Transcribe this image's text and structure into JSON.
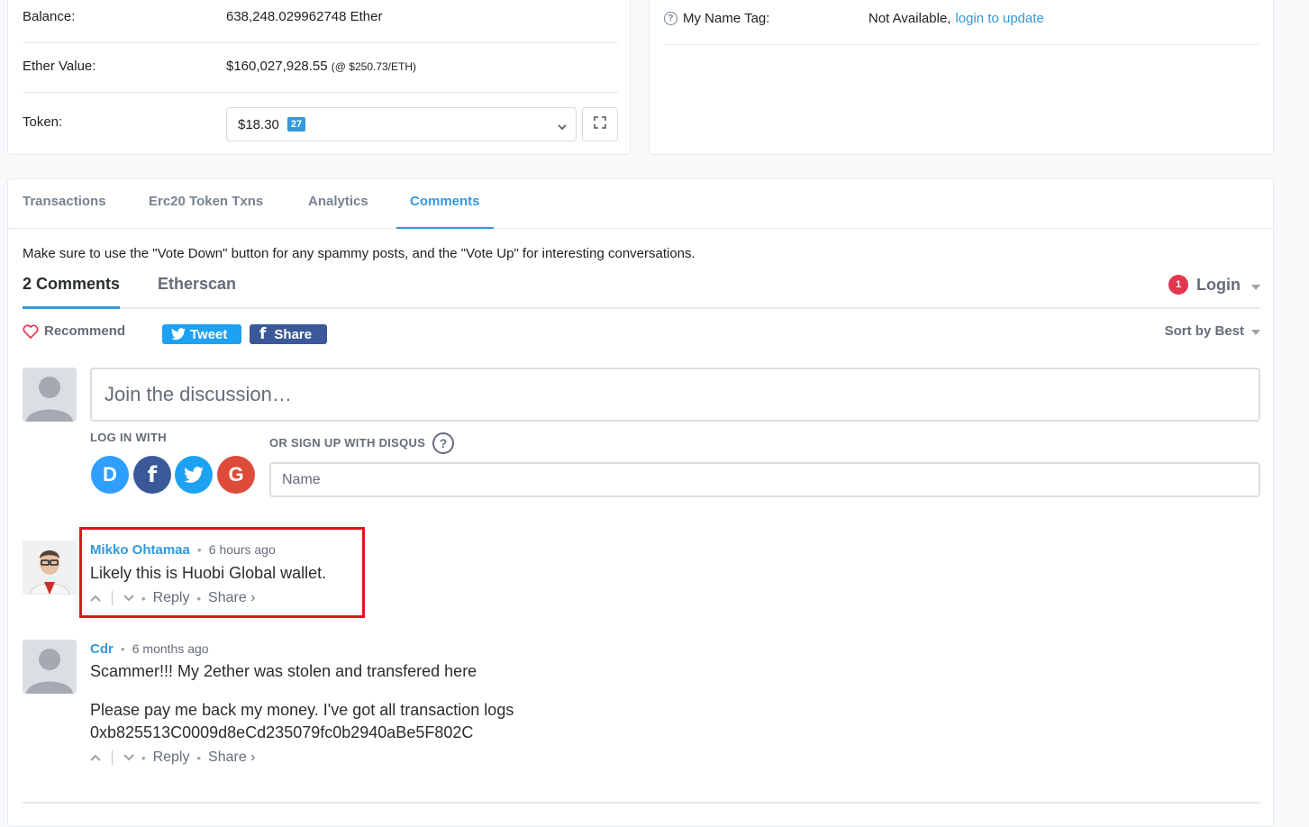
{
  "overview": {
    "balance_label": "Balance:",
    "balance_value": "638,248.029962748 Ether",
    "ether_value_label": "Ether Value:",
    "ether_value": "$160,027,928.55",
    "ether_rate": "(@ $250.73/ETH)",
    "token_label": "Token:",
    "token_value": "$18.30",
    "token_count": "27"
  },
  "more_info": {
    "name_tag_label": "My Name Tag:",
    "name_tag_value": "Not Available,",
    "name_tag_link": "login to update"
  },
  "tabs": [
    {
      "label": "Transactions"
    },
    {
      "label": "Erc20 Token Txns"
    },
    {
      "label": "Analytics"
    },
    {
      "label": "Comments",
      "active": true
    }
  ],
  "notice": "Make sure to use the \"Vote Down\" button for any spammy posts, and the \"Vote Up\" for interesting conversations.",
  "disqus": {
    "comment_count": "2 Comments",
    "forum_name": "Etherscan",
    "notification_count": "1",
    "login_label": "Login",
    "recommend_label": "Recommend",
    "tweet_label": "Tweet",
    "share_label": "Share",
    "sort_label": "Sort by Best",
    "composer_placeholder": "Join the discussion…",
    "log_in_with": "LOG IN WITH",
    "or_sign_up": "OR SIGN UP WITH DISQUS",
    "name_placeholder": "Name",
    "social_logins": [
      "D",
      "f",
      "t",
      "G"
    ]
  },
  "comments": [
    {
      "author": "Mikko Ohtamaa",
      "time": "6 hours ago",
      "text": [
        "Likely this is Huobi Global wallet."
      ],
      "reply_label": "Reply",
      "share_label": "Share ›"
    },
    {
      "author": "Cdr",
      "time": "6 months ago",
      "text": [
        "Scammer!!! My 2ether was stolen and transfered here",
        "Please pay me back my money. I've got all transaction logs",
        "0xb825513C0009d8eCd235079fc0b2940aBe5F802C"
      ],
      "reply_label": "Reply",
      "share_label": "Share ›"
    }
  ],
  "colors": {
    "accent": "#3498db",
    "highlight": "#e0141e",
    "twitter": "#1da1f2",
    "facebook": "#3b5998",
    "google": "#dd4b39",
    "disqus": "#2e9fff"
  }
}
